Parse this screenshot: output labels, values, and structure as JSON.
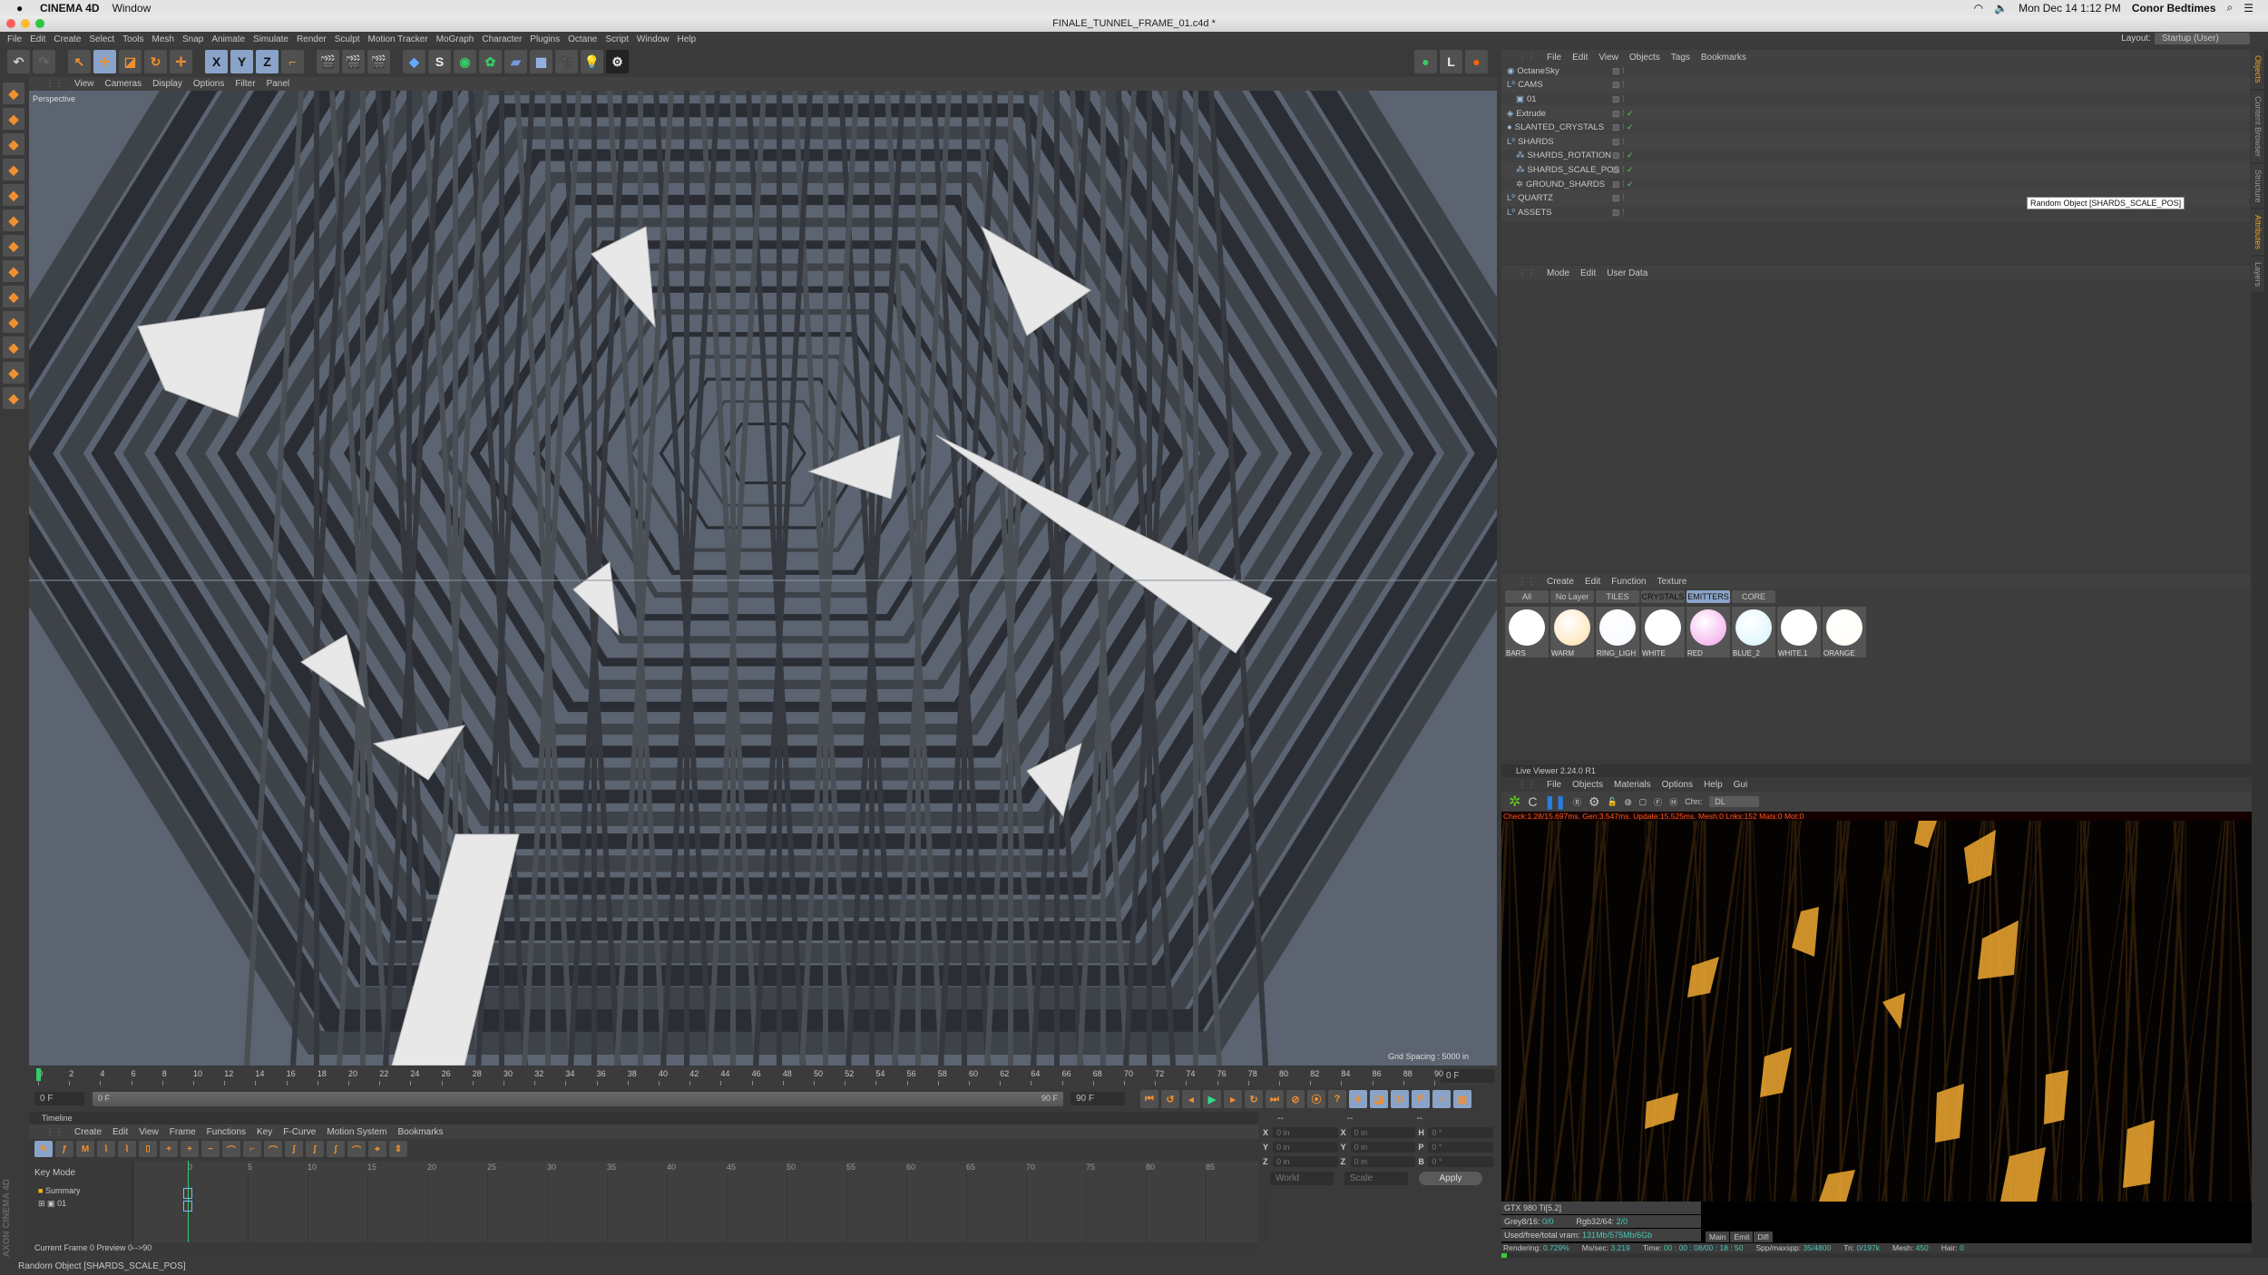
{
  "mac": {
    "app": "CINEMA 4D",
    "menu": "Window",
    "clock": "Mon Dec 14  1:12 PM",
    "user": "Conor Bedtimes"
  },
  "window": {
    "title": "FINALE_TUNNEL_FRAME_01.c4d *"
  },
  "menu": [
    "File",
    "Edit",
    "Create",
    "Select",
    "Tools",
    "Mesh",
    "Snap",
    "Animate",
    "Simulate",
    "Render",
    "Sculpt",
    "Motion Tracker",
    "MoGraph",
    "Character",
    "Plugins",
    "Octane",
    "Script",
    "Window",
    "Help"
  ],
  "layout": {
    "label": "Layout:",
    "value": "Startup (User)"
  },
  "toolbar": {
    "axis": [
      "X",
      "Y",
      "Z"
    ]
  },
  "viewport": {
    "menu": [
      "View",
      "Cameras",
      "Display",
      "Options",
      "Filter",
      "Panel"
    ],
    "label": "Perspective",
    "grid": "Grid Spacing : 5000 in"
  },
  "ruler": {
    "ticks": [
      0,
      2,
      4,
      6,
      8,
      10,
      12,
      14,
      16,
      18,
      20,
      22,
      24,
      26,
      28,
      30,
      32,
      34,
      36,
      38,
      40,
      42,
      44,
      46,
      48,
      50,
      52,
      54,
      56,
      58,
      60,
      62,
      64,
      66,
      68,
      70,
      72,
      74,
      76,
      78,
      80,
      82,
      84,
      86,
      88,
      90
    ],
    "end_field": "0 F"
  },
  "slider": {
    "start": "0 F",
    "min_label": "0 F",
    "max_label": "90 F",
    "end": "90 F"
  },
  "timeline": {
    "title": "Timeline",
    "menu": [
      "Create",
      "Edit",
      "View",
      "Frame",
      "Functions",
      "Key",
      "F-Curve",
      "Motion System",
      "Bookmarks"
    ],
    "key_mode": "Key Mode",
    "ticks": [
      0,
      5,
      10,
      15,
      20,
      25,
      30,
      35,
      40,
      45,
      50,
      55,
      60,
      65,
      70,
      75,
      80,
      85,
      90
    ],
    "tracks": [
      "Summary",
      "01"
    ],
    "footer": "Current Frame  0  Preview  0-->90",
    "brand": "MAXON CINEMA 4D"
  },
  "coords": {
    "headers": [
      "--",
      "--",
      "--"
    ],
    "rows": [
      [
        "X",
        "0 in",
        "X",
        "0 in",
        "H",
        "0 °"
      ],
      [
        "Y",
        "0 in",
        "Y",
        "0 in",
        "P",
        "0 °"
      ],
      [
        "Z",
        "0 in",
        "Z",
        "0 in",
        "B",
        "0 °"
      ]
    ],
    "mode1": "World",
    "mode2": "Scale",
    "apply": "Apply"
  },
  "status": "Random Object [SHARDS_SCALE_POS]",
  "objects": {
    "menu": [
      "File",
      "Edit",
      "View",
      "Objects",
      "Tags",
      "Bookmarks"
    ],
    "items": [
      {
        "name": "OctaneSky",
        "indent": 0,
        "check": ""
      },
      {
        "name": "CAMS",
        "indent": 0,
        "check": ""
      },
      {
        "name": "01",
        "indent": 1,
        "check": ""
      },
      {
        "name": "Extrude",
        "indent": 0,
        "check": "✓"
      },
      {
        "name": "SLANTED_CRYSTALS",
        "indent": 0,
        "check": "✓"
      },
      {
        "name": "SHARDS",
        "indent": 0,
        "check": ""
      },
      {
        "name": "SHARDS_ROTATION",
        "indent": 1,
        "check": "✓"
      },
      {
        "name": "SHARDS_SCALE_POS",
        "indent": 1,
        "check": "✓"
      },
      {
        "name": "GROUND_SHARDS",
        "indent": 1,
        "check": "✓"
      },
      {
        "name": "QUARTZ",
        "indent": 0,
        "check": ""
      },
      {
        "name": "ASSETS",
        "indent": 0,
        "check": ""
      }
    ],
    "tooltip": "Random Object [SHARDS_SCALE_POS]"
  },
  "attributes": {
    "menu": [
      "Mode",
      "Edit",
      "User Data"
    ]
  },
  "materials": {
    "menu": [
      "Create",
      "Edit",
      "Function",
      "Texture"
    ],
    "tabs": [
      "All",
      "No Layer",
      "TILES",
      "CRYSTALS",
      "EMITTERS",
      "CORE"
    ],
    "active_tab": "EMITTERS",
    "items": [
      {
        "name": "BARS",
        "color": "#ffffff"
      },
      {
        "name": "WARM",
        "color": "#ffe0a8"
      },
      {
        "name": "RING_LIGH",
        "color": "#f4f8ff"
      },
      {
        "name": "WHITE",
        "color": "#ffffff"
      },
      {
        "name": "RED",
        "color": "#f2a0e8"
      },
      {
        "name": "BLUE_2",
        "color": "#d6f4fb"
      },
      {
        "name": "WHITE.1",
        "color": "#ffffff"
      },
      {
        "name": "ORANGE",
        "color": "#fffdf4"
      }
    ]
  },
  "live": {
    "title": "Live Viewer 2.24.0 R1",
    "menu": [
      "File",
      "Objects",
      "Materials",
      "Options",
      "Help",
      "Gui"
    ],
    "chn_label": "Chn:",
    "chn": "DL",
    "log": "Check:1.28/15.697ms. Gen:3.547ms. Update:15.525ms. Mesh:0 Lnks:152 Mats:0 Mot:0",
    "gpu": "GTX 980 Ti[5.2]",
    "grey": "0/0",
    "rgb": "2/0",
    "vram": "131Mb/575Mb/6Gb",
    "tabs": [
      "Main",
      "Emit",
      "Difl"
    ],
    "rendering": "0.729%",
    "mssec": "3.219",
    "time": "00 : 00 : 08/00 : 18 : 50",
    "spp": "35/4800",
    "tri": "0/197k",
    "mesh": "450",
    "hair": "0",
    "progress": 0.729
  },
  "side_tabs": [
    "Objects",
    "Content Browser",
    "Structure",
    "Attributes",
    "Layers"
  ]
}
